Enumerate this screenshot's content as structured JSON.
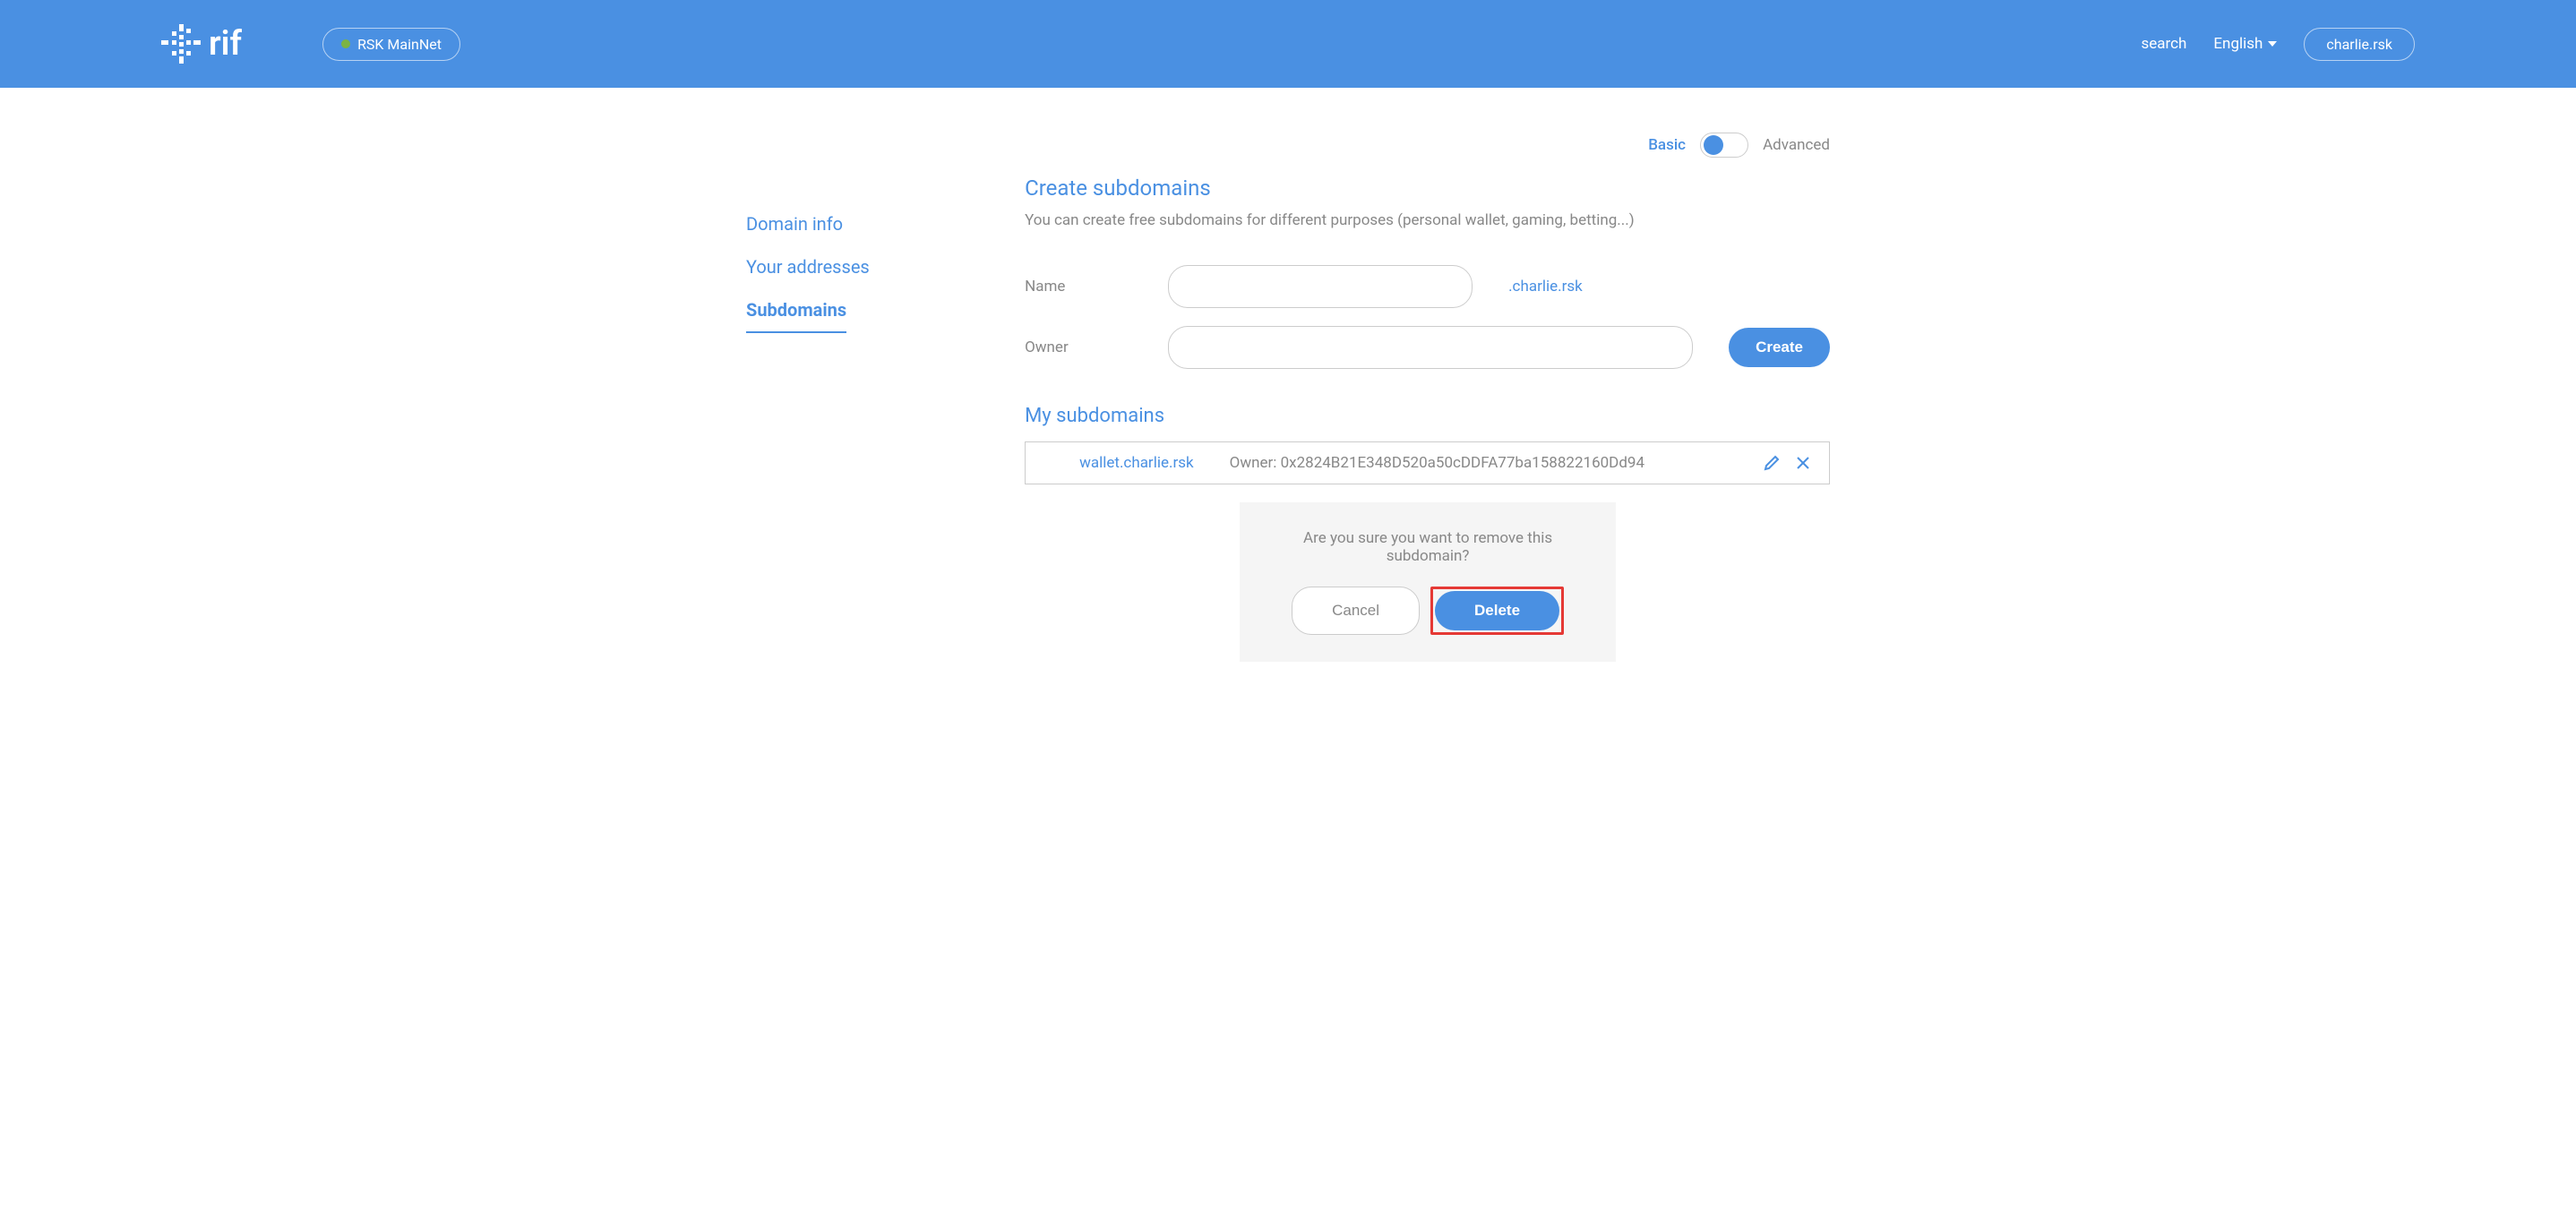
{
  "header": {
    "logo_text": "rif",
    "network": "RSK MainNet",
    "search": "search",
    "language": "English",
    "user": "charlie.rsk"
  },
  "mode": {
    "basic": "Basic",
    "advanced": "Advanced"
  },
  "sidebar": {
    "items": [
      "Domain info",
      "Your addresses",
      "Subdomains"
    ]
  },
  "create": {
    "title": "Create subdomains",
    "desc": "You can create free subdomains for different purposes (personal wallet, gaming, betting...)",
    "name_label": "Name",
    "owner_label": "Owner",
    "suffix": ".charlie.rsk",
    "button": "Create"
  },
  "list": {
    "title": "My subdomains",
    "items": [
      {
        "name": "wallet.charlie.rsk",
        "owner_prefix": "Owner: ",
        "owner": "0x2824B21E348D520a50cDDFA77ba158822160Dd94"
      }
    ]
  },
  "confirm": {
    "text": "Are you sure you want to remove this subdomain?",
    "cancel": "Cancel",
    "delete": "Delete"
  }
}
